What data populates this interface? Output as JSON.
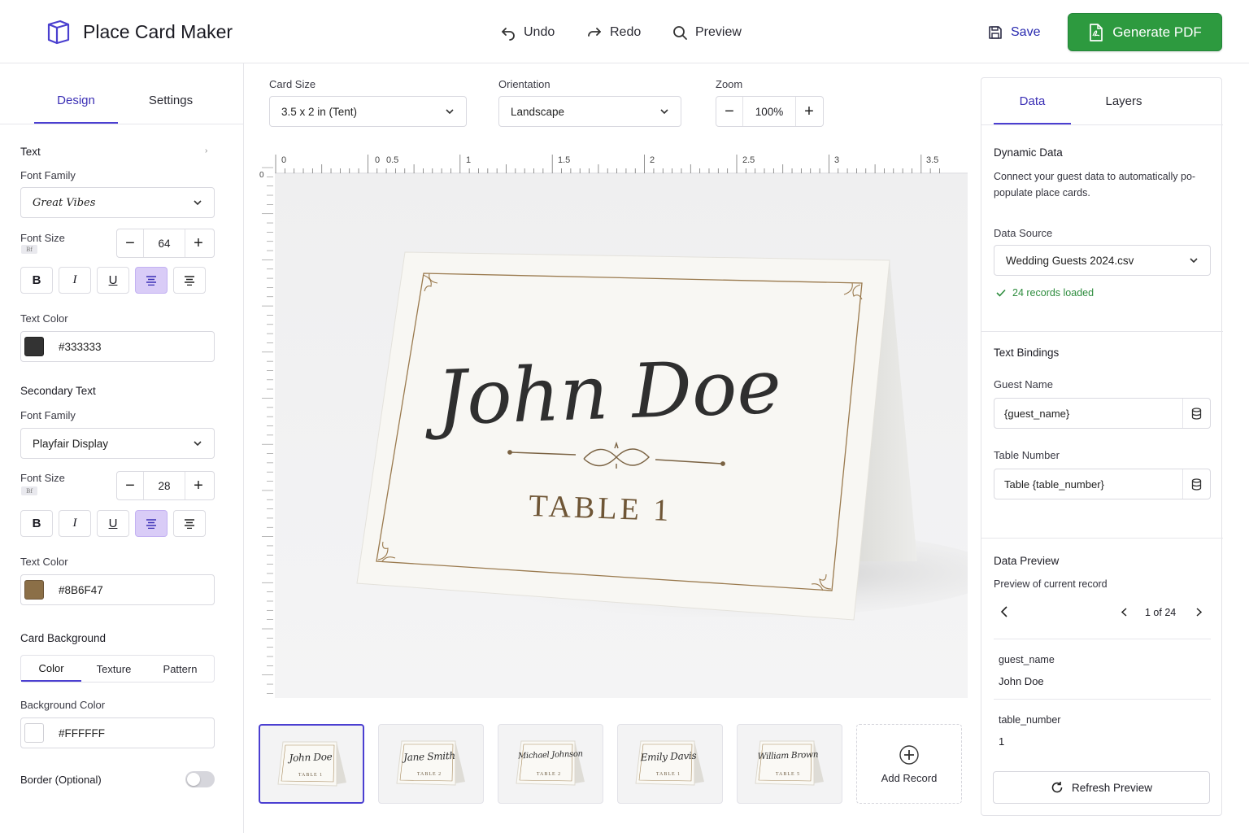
{
  "header": {
    "app_title": "Place Card Maker",
    "logo_icon": "cube-icon",
    "undo_label": "Undo",
    "redo_label": "Redo",
    "preview_label": "Preview",
    "save_label": "Save",
    "generate_label": "Generate PDF",
    "generate_color": "#2d9a3f"
  },
  "left_panel": {
    "tabs": [
      "Design",
      "Settings"
    ],
    "active_tab": "Design",
    "text_section": {
      "title": "Text",
      "font_family_label": "Font Family",
      "font_family_value": "Great Vibes",
      "font_size_label": "Font Size",
      "font_size_value": "64",
      "text_color_label": "Text Color",
      "text_color_value": "#333333"
    },
    "secondary_section": {
      "title": "Secondary Text",
      "font_family_label": "Font Family",
      "font_family_value": "Playfair Display",
      "font_size_label": "Font Size",
      "font_size_value": "28",
      "text_color_label": "Text Color",
      "text_color_value": "#8B6F47"
    },
    "background_section": {
      "title": "Card Background",
      "modes": [
        "Color",
        "Texture",
        "Pattern"
      ],
      "active_mode": "Color",
      "bg_color_label": "Background Color",
      "bg_color_value": "#FFFFFF"
    },
    "border_label": "Border (Optional)",
    "border_enabled": false,
    "format_buttons": {
      "bold": "B",
      "italic": "I",
      "underline": "U"
    }
  },
  "toolbar": {
    "card_size_label": "Card Size",
    "card_size_value": "3.5 x 2 in (Tent)",
    "orientation_label": "Orientation",
    "orientation_value": "Landscape",
    "zoom_label": "Zoom",
    "zoom_value": "100%"
  },
  "ruler": {
    "h_ticks": [
      "0",
      "0",
      "0.5",
      "1",
      "1.5",
      "2",
      "2.5",
      "3",
      "3.5"
    ],
    "v_ticks": [
      "0"
    ]
  },
  "card_preview": {
    "guest_name": "John Doe",
    "table_text": "TABLE 1",
    "name_color": "#333333",
    "table_color": "#8B6F47"
  },
  "thumbnails": [
    {
      "name": "John Doe",
      "table": "TABLE 1"
    },
    {
      "name": "Jane Smith",
      "table": "TABLE 2"
    },
    {
      "name": "Michael Johnson",
      "table": "TABLE 2"
    },
    {
      "name": "Emily Davis",
      "table": "TABLE 1"
    },
    {
      "name": "William Brown",
      "table": "TABLE 5"
    }
  ],
  "add_record_label": "Add Record",
  "right_panel": {
    "tabs": [
      "Data",
      "Layers"
    ],
    "active_tab": "Data",
    "dynamic_title": "Dynamic Data",
    "dynamic_desc": "Connect your guest data to automatically po-populate place cards.",
    "data_source_label": "Data Source",
    "data_source_value": "Wedding Guests 2024.csv",
    "records_status": "24 records loaded",
    "bindings_title": "Text Bindings",
    "guest_name_label": "Guest Name",
    "guest_name_binding": "{guest_name}",
    "table_number_label": "Table Number",
    "table_number_binding": "Table {table_number}",
    "preview_title": "Data Preview",
    "preview_desc": "Preview of current record",
    "record_position": "1 of 24",
    "fields": [
      {
        "key": "guest_name",
        "value": "John Doe"
      },
      {
        "key": "table_number",
        "value": "1"
      }
    ],
    "refresh_label": "Refresh Preview"
  }
}
